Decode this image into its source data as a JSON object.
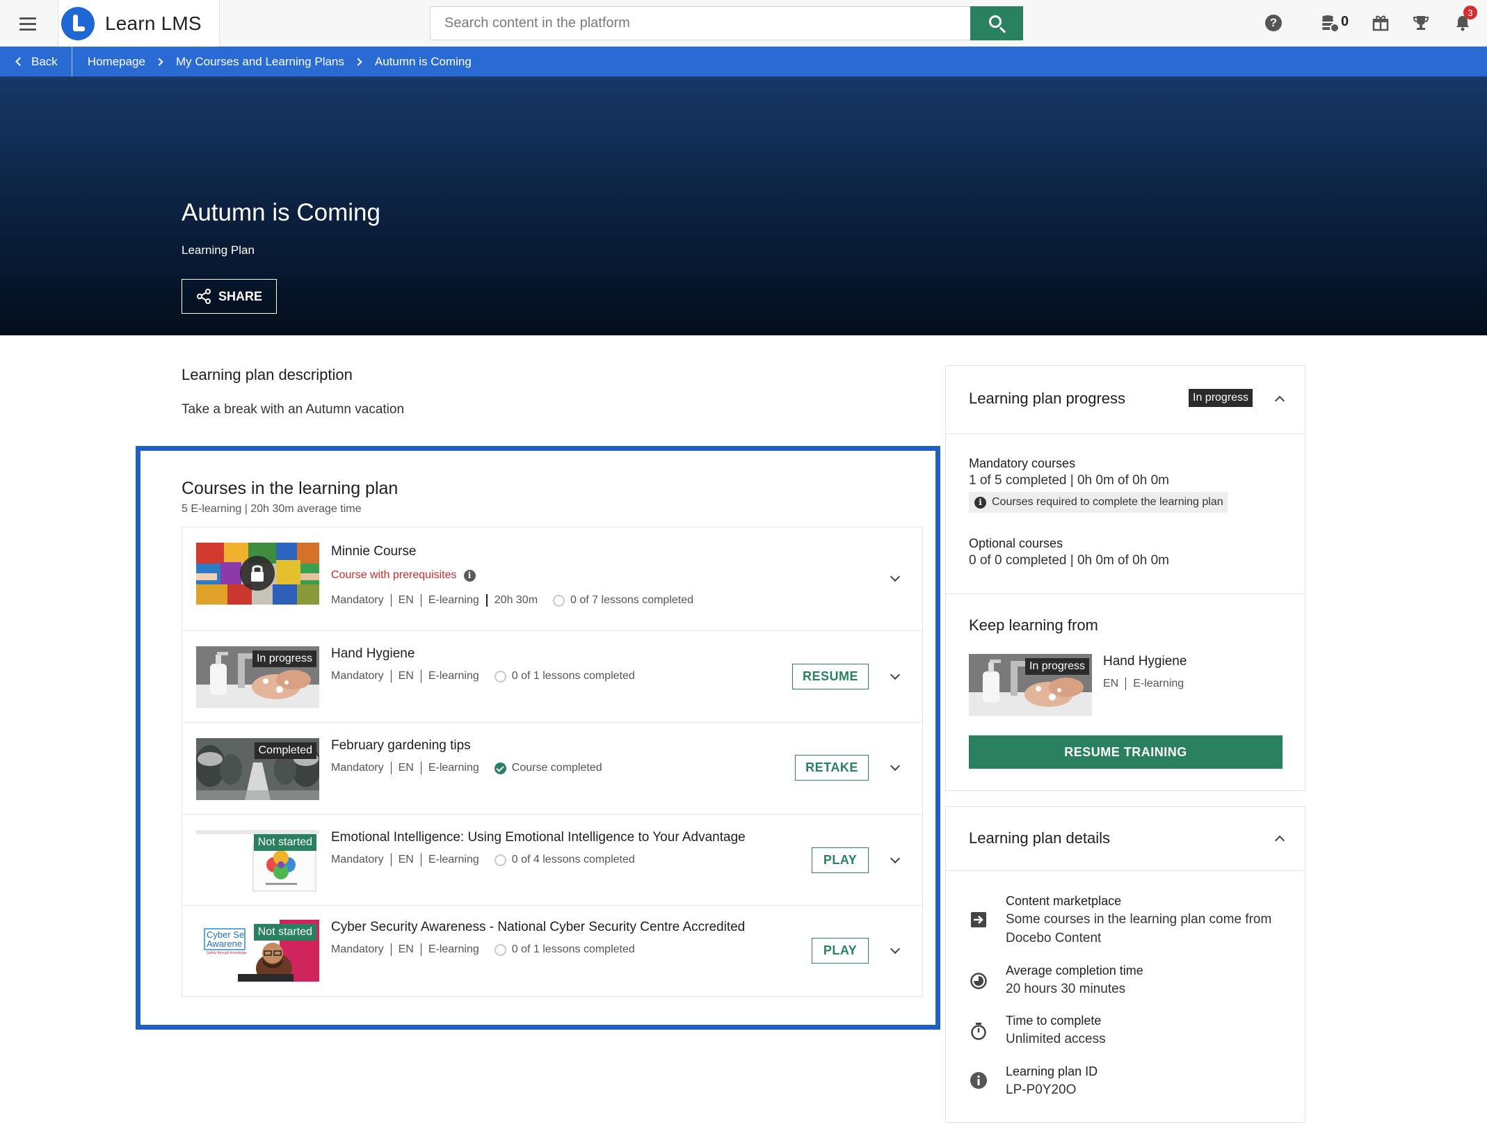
{
  "header": {
    "app_name": "Learn LMS",
    "search_placeholder": "Search content in the platform",
    "coins_count": "0",
    "notifications_count": "3"
  },
  "breadcrumb": {
    "back_label": "Back",
    "items": [
      "Homepage",
      "My Courses and Learning Plans",
      "Autumn is Coming"
    ]
  },
  "hero": {
    "title": "Autumn is Coming",
    "subtitle": "Learning Plan",
    "share_label": "SHARE"
  },
  "description": {
    "title": "Learning plan description",
    "text": "Take a break with an Autumn vacation"
  },
  "courses": {
    "title": "Courses in the learning plan",
    "subtitle": "5 E-learning | 20h 30m average time",
    "items": [
      {
        "name": "Minnie Course",
        "prereq": "Course with prerequisites",
        "meta": [
          "Mandatory",
          "EN",
          "E-learning",
          "20h 30m"
        ],
        "lessons": "0 of 7 lessons completed"
      },
      {
        "name": "Hand Hygiene",
        "badge": "In progress",
        "meta": [
          "Mandatory",
          "EN",
          "E-learning"
        ],
        "lessons": "0 of 1 lessons completed",
        "action": "RESUME"
      },
      {
        "name": "February gardening tips",
        "badge": "Completed",
        "meta": [
          "Mandatory",
          "EN",
          "E-learning"
        ],
        "lessons": "Course completed",
        "action": "RETAKE"
      },
      {
        "name": "Emotional Intelligence: Using Emotional Intelligence to Your Advantage",
        "badge": "Not started",
        "meta": [
          "Mandatory",
          "EN",
          "E-learning"
        ],
        "lessons": "0 of 4 lessons completed",
        "action": "PLAY"
      },
      {
        "name": "Cyber Security Awareness - National Cyber Security Centre Accredited",
        "badge": "Not started",
        "meta": [
          "Mandatory",
          "EN",
          "E-learning"
        ],
        "lessons": "0 of 1 lessons completed",
        "action": "PLAY",
        "thumb_text": "Cyber Se",
        "thumb_text2": "Awarene",
        "thumb_text3": "Safety through knowledge"
      }
    ]
  },
  "progress": {
    "title": "Learning plan progress",
    "status": "In progress",
    "mandatory_label": "Mandatory courses",
    "mandatory_value": "1 of 5 completed | 0h 0m of 0h 0m",
    "required_note": "Courses required to complete the learning plan",
    "optional_label": "Optional courses",
    "optional_value": "0 of 0 completed | 0h 0m of 0h 0m",
    "keep_title": "Keep learning from",
    "keep_course": "Hand Hygiene",
    "keep_badge": "In progress",
    "keep_meta": [
      "EN",
      "E-learning"
    ],
    "resume_label": "RESUME TRAINING"
  },
  "details": {
    "title": "Learning plan details",
    "items": [
      {
        "label": "Content marketplace",
        "value": "Some courses in the learning plan come from Docebo Content"
      },
      {
        "label": "Average completion time",
        "value": "20 hours 30 minutes"
      },
      {
        "label": "Time to complete",
        "value": "Unlimited access"
      },
      {
        "label": "Learning plan ID",
        "value": "LP-P0Y20O"
      }
    ]
  },
  "colors": {
    "brand_blue": "#2a6bd3",
    "accent_green": "#2a8160",
    "prereq_red": "#cf2a2a"
  }
}
